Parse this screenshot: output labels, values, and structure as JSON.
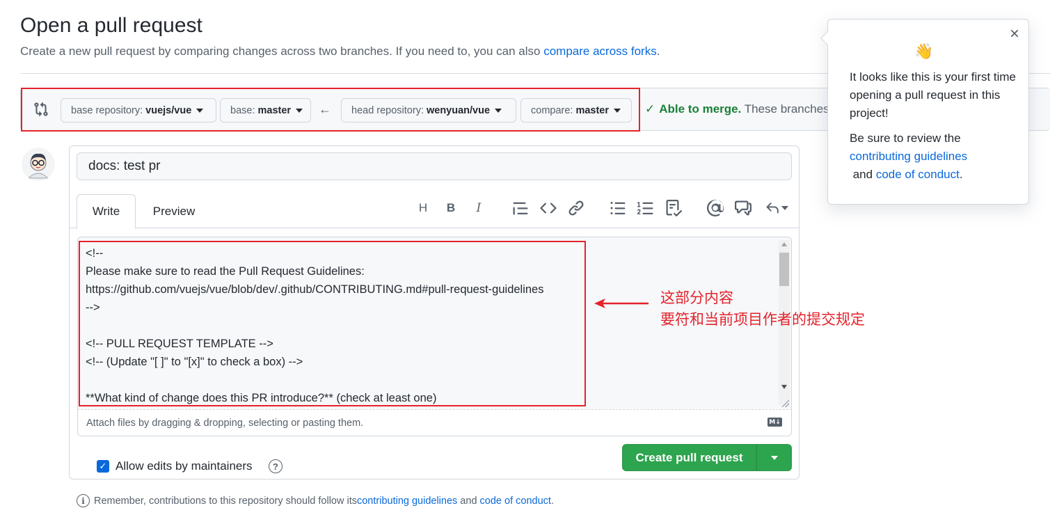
{
  "header": {
    "title": "Open a pull request",
    "subtitle_prefix": "Create a new pull request by comparing changes across two branches. If you need to, you can also ",
    "subtitle_link": "compare across forks",
    "subtitle_suffix": "."
  },
  "range": {
    "base_repo_label": "base repository:",
    "base_repo_value": "vuejs/vue",
    "base_label": "base:",
    "base_value": "master",
    "head_repo_label": "head repository:",
    "head_repo_value": "wenyuan/vue",
    "compare_label": "compare:",
    "compare_value": "master",
    "merge_ok": "Able to merge.",
    "merge_text": " These branches"
  },
  "form": {
    "title_value": "docs: test pr",
    "tab_write": "Write",
    "tab_preview": "Preview",
    "toolbar": {
      "heading": "H",
      "bold": "B",
      "italic": "I"
    },
    "body_text": "<!--\nPlease make sure to read the Pull Request Guidelines:\nhttps://github.com/vuejs/vue/blob/dev/.github/CONTRIBUTING.md#pull-request-guidelines\n-->\n\n<!-- PULL REQUEST TEMPLATE -->\n<!-- (Update \"[ ]\" to \"[x]\" to check a box) -->\n\n**What kind of change does this PR introduce?** (check at least one)",
    "attach_hint": "Attach files by dragging & dropping, selecting or pasting them.",
    "markdown_badge": "M↓",
    "allow_edits": "Allow edits by maintainers",
    "allow_edits_checked": true,
    "create_button": "Create pull request"
  },
  "annotation": {
    "line1": "这部分内容",
    "line2": "要符和当前项目作者的提交规定",
    "color": "#e5222b"
  },
  "footer": {
    "prefix": "Remember, contributions to this repository should follow its ",
    "link1": "contributing guidelines",
    "middle": " and ",
    "link2": "code of conduct",
    "suffix": "."
  },
  "popover": {
    "emoji": "👋",
    "text1": "It looks like this is your first time opening a pull request in this project!",
    "text2_prefix": "Be sure to review the ",
    "link1": "contributing guidelines",
    "text2_middle": " and ",
    "link2": "code of conduct",
    "text2_suffix": "."
  },
  "colors": {
    "accent_link": "#0969da",
    "success_green": "#2da44e",
    "merge_green": "#1a7f37",
    "annotation_red": "#e5222b"
  }
}
